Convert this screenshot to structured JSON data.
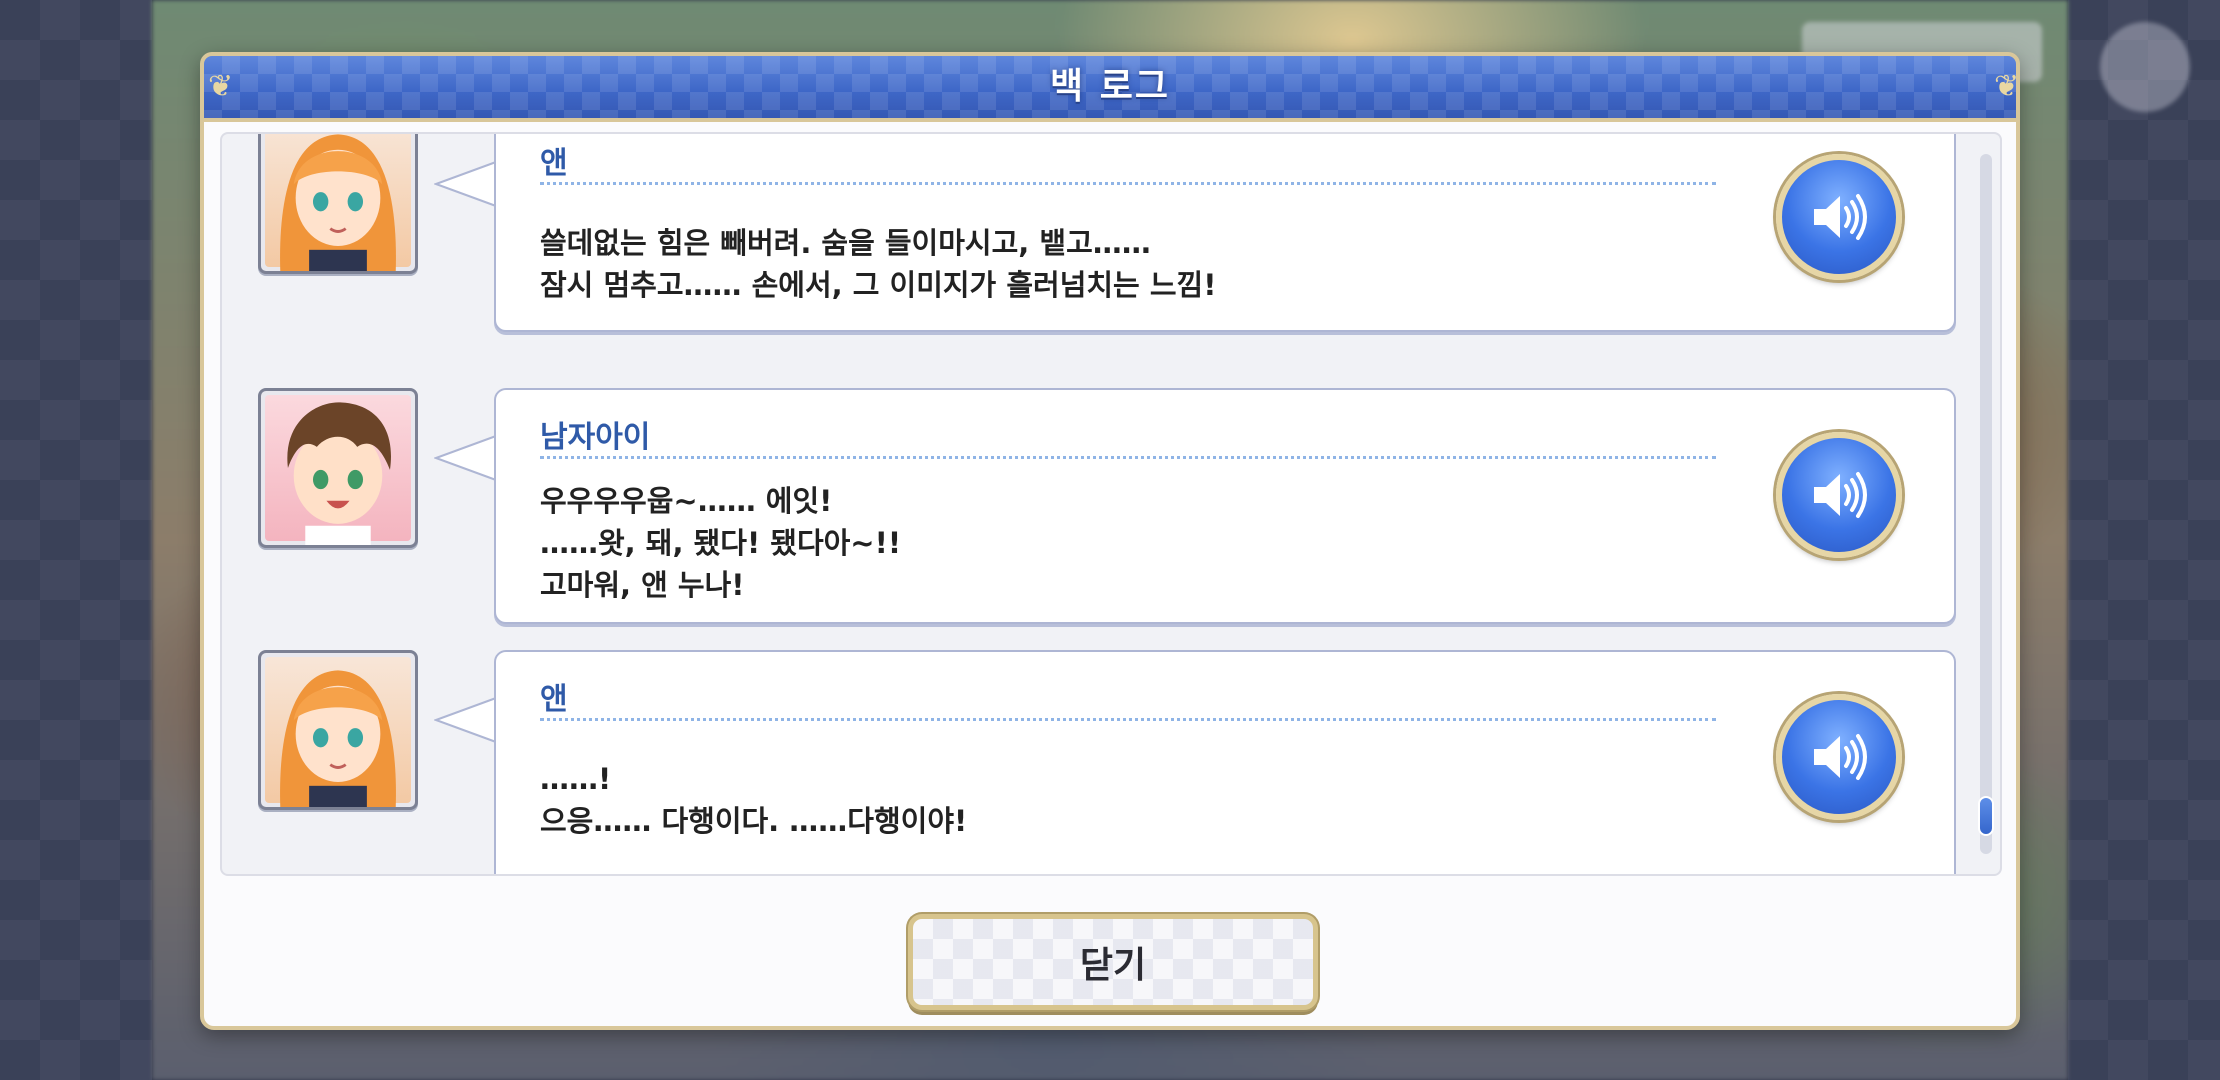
{
  "dialog": {
    "title": "백 로그",
    "close_label": "닫기"
  },
  "entries": [
    {
      "speaker": "앤",
      "lines": [
        "쓸데없는 힘은 빼버려. 숨을 들이마시고, 뱉고……",
        "잠시 멈추고…… 손에서, 그 이미지가 흘러넘치는 느낌!"
      ]
    },
    {
      "speaker": "남자아이",
      "lines": [
        "우우우우웁~…… 에잇!",
        "……왓, 돼, 됐다! 됐다아~!!",
        "고마워, 앤 누나!"
      ]
    },
    {
      "speaker": "앤",
      "lines": [
        "……!",
        "으응…… 다행이다. ……다행이야!"
      ]
    }
  ],
  "icons": {
    "voice": "speaker-volume-icon",
    "corner": "ornament-icon"
  },
  "colors": {
    "header_blue": "#3f68c8",
    "speaker_name": "#2f5aa8",
    "gold_border": "#d9c79a",
    "voice_button": "#3b74e6"
  }
}
